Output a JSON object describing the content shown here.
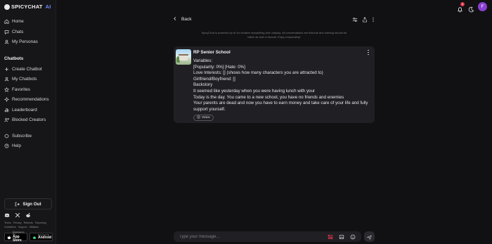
{
  "brand": {
    "name": "SPICYCHAT",
    "suffix": "AI"
  },
  "sidebar": {
    "main_items": [
      {
        "label": "Home",
        "icon": "home-icon"
      },
      {
        "label": "Chats",
        "icon": "chat-icon"
      },
      {
        "label": "My Personas",
        "icon": "persona-icon"
      }
    ],
    "section_title": "Chatbots",
    "chatbot_items": [
      {
        "label": "Create Chatbot",
        "icon": "plus-icon"
      },
      {
        "label": "My Chatbots",
        "icon": "bot-icon"
      },
      {
        "label": "Favorites",
        "icon": "star-icon"
      },
      {
        "label": "Recommendations",
        "icon": "sparkle-icon"
      },
      {
        "label": "Leaderboard",
        "icon": "leaderboard-icon"
      },
      {
        "label": "Blocked Creators",
        "icon": "blocked-icon"
      }
    ],
    "extra_items": [
      {
        "label": "Subscribe",
        "icon": "subscribe-icon"
      },
      {
        "label": "Help",
        "icon": "help-icon"
      }
    ],
    "sign_out_label": "Sign Out",
    "footer_links": [
      "Terms",
      "Privacy",
      "Refunds",
      "Reporting",
      "Guidelines",
      "Support",
      "Affiliates"
    ],
    "app_store": {
      "small": "Download on the",
      "big": "App Store"
    },
    "google_play": {
      "small": "Download for",
      "big": "Android"
    }
  },
  "header": {
    "back_label": "Back",
    "notification_count": "1",
    "user_initial": "F"
  },
  "disclaimer": "SpicyChat is powered by AI for creative storytelling and roleplay. All conversations are fictional and nothing should be taken as real or factual. Enjoy responsibly!",
  "message": {
    "bot_name": "RP Senior School",
    "lines": [
      "Variables:",
      "[Popularity: 0%] [Hate: 0%]",
      "Love Interests: [] (shows how many characters you are attracted to)",
      "Girlfriend/Boyfriend: []",
      "Backstory",
      "It seemed like yesterday when you were having lunch with your",
      "Today is the day. You came to a new school, you have no friends and enemies",
      "Your parents are dead and now you have to earn money and take care of your life and fully",
      "support yourself."
    ],
    "voice_label": "Voice"
  },
  "composer": {
    "placeholder": "Type your message..."
  },
  "colors": {
    "background": "#111113",
    "card": "#202024",
    "accent": "#6b8cff",
    "badge": "#e3344e",
    "avatar": "#8a3fd1"
  }
}
